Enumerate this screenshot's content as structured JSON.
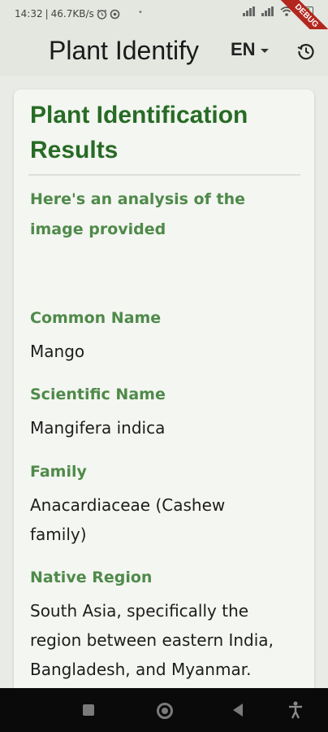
{
  "status_bar": {
    "time": "14:32",
    "network_speed": "46.7KB/s",
    "separator": "|",
    "dot": "•",
    "debug_label": "DEBUG",
    "icons": [
      "alarm-icon",
      "sync-icon",
      "signal-icon",
      "wifi-icon",
      "battery-icon"
    ]
  },
  "app_bar": {
    "title": "Plant Identify",
    "language": "EN",
    "history_icon": "history-icon"
  },
  "card": {
    "title": "Plant Identification Results",
    "intro": "Here's an analysis of the image provided",
    "fields": [
      {
        "label": "Common Name",
        "value": "Mango"
      },
      {
        "label": "Scientific Name",
        "value": "Mangifera indica"
      },
      {
        "label": "Family",
        "value": "Anacardiaceae (Cashew family)"
      },
      {
        "label": "Native Region",
        "value": "South Asia, specifically the region between eastern India, Bangladesh, and Myanmar."
      }
    ]
  },
  "nav_bar": {
    "icons": [
      "recents-icon",
      "home-icon",
      "back-icon",
      "accessibility-icon"
    ]
  },
  "colors": {
    "title_green": "#276b25",
    "label_green": "#4f8a4a",
    "card_background": "#f4f6f1",
    "app_background": "#e9ece6"
  }
}
